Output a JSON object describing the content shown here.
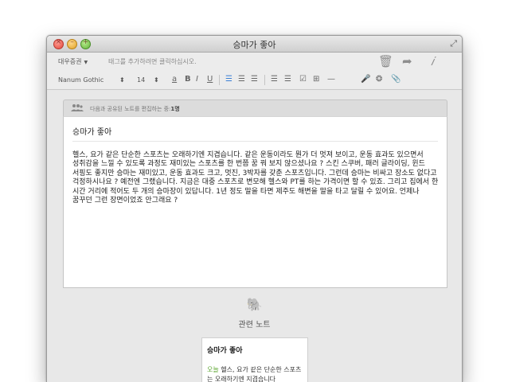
{
  "window": {
    "title": "승마가 좋아",
    "close_glyph": "×",
    "minimize_glyph": "–",
    "maximize_glyph": "+",
    "fullscreen_icon": "fullscreen-arrows-icon",
    "fullscreen_glyph": "⤢"
  },
  "toolbar": {
    "notebook": "대우증권",
    "notebook_arrow": "▼",
    "tag_placeholder": "태그를 추가하려면 클릭하십시오.",
    "icons": [
      {
        "name": "trash-icon",
        "glyph": "🗑"
      },
      {
        "name": "share-arrow-icon",
        "glyph": "➦"
      },
      {
        "name": "info-icon",
        "glyph": "𝑖"
      }
    ]
  },
  "format_bar": {
    "font": "Nanum Gothic",
    "font_stepper": "⬍",
    "size": "14",
    "size_stepper": "⬍",
    "text_color": "a",
    "bold": "B",
    "italic": "I",
    "underline": "U",
    "align_left": "☰",
    "align_center": "☰",
    "align_right": "☰",
    "bullet_list": "☰",
    "numbered_list": "☰",
    "checkbox": "☑",
    "table": "⊞",
    "horizontal_rule": "—",
    "microphone": "🎤",
    "emoji": "❂",
    "attach": "📎",
    "accent_color": "#3a7fd5"
  },
  "share_bar": {
    "text": "다음과 공유된 노트를 편집하는 중:",
    "count": "1명",
    "icon": "people-icon"
  },
  "note": {
    "title": "승마가 좋아",
    "body": "헬스, 요가 같은 단순한 스포츠는 오래하기엔 지겹습니다. 같은 운동이라도 뭔가 더 멋져 보이고, 운동 효과도 있으면서 성취감을 느낄 수 있도록 과정도 재미있는 스포츠를 한 번쯤 꿈 꿔 보지 않으셨나요 ? 스킨 스쿠버, 패러 글라이딩, 윈드 서핑도 좋지만 승마는 재미있고, 운동 효과도 크고, 멋진, 3박자를 갖춘 스포츠입니다. 그런데 승마는 비싸고 장소도 없다고 걱정하시나요 ? 예전엔 그랬습니다. 지금은 대중 스포츠로 변모해 헬스와 PT를 하는 가격이면 할 수 있죠. 그리고 집에서 한 시간 거리에 적어도 두 개의 승마장이 있답니다. 1년 정도 말을 타면 제주도 해변을 말을 타고 달릴 수 있어요. 언제나 꿈꾸던 그런 장면이었죠 안그래요 ?"
  },
  "related": {
    "icon": "elephant-icon",
    "icon_glyph": "🐘",
    "title": "관련 노트",
    "card": {
      "title": "승마가 좋아",
      "date": "오늘",
      "snippet": "헬스, 요가 같은 단순한 스포츠는 오래하기엔 지겹습니다"
    },
    "date_color": "#5ba52f"
  }
}
